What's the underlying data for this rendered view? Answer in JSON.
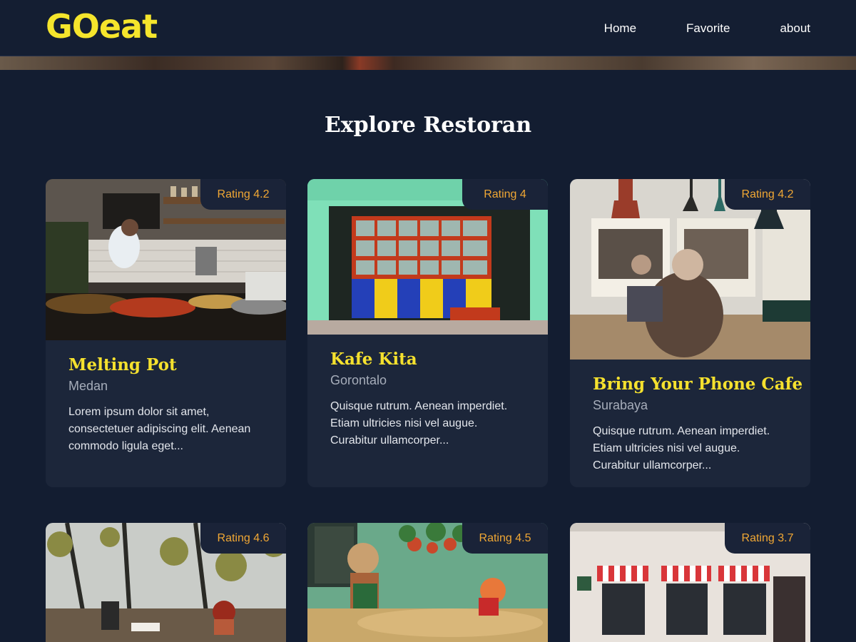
{
  "brand": {
    "logo_text": "GOeat",
    "logo_color": "#f5e52c"
  },
  "nav": {
    "items": [
      "Home",
      "Favorite",
      "about"
    ]
  },
  "section": {
    "title": "Explore Restoran"
  },
  "restaurants": [
    {
      "rating": "Rating 4.2",
      "name": "Melting Pot",
      "city": "Medan",
      "description": "Lorem ipsum dolor sit amet, consectetuer adipiscing elit. Aenean commodo ligula eget..."
    },
    {
      "rating": "Rating 4",
      "name": "Kafe Kita",
      "city": "Gorontalo",
      "description": "Quisque rutrum. Aenean imperdiet. Etiam ultricies nisi vel augue. Curabitur ullamcorper..."
    },
    {
      "rating": "Rating 4.2",
      "name": "Bring Your Phone Cafe",
      "city": "Surabaya",
      "description": "Quisque rutrum. Aenean imperdiet. Etiam ultricies nisi vel augue. Curabitur ullamcorper..."
    },
    {
      "rating": "Rating 4.6"
    },
    {
      "rating": "Rating 4.5"
    },
    {
      "rating": "Rating 3.7"
    }
  ],
  "colors": {
    "background": "#131d31",
    "card": "#1c263a",
    "accent_name": "#f5e12e",
    "rating": "#f0a734"
  }
}
